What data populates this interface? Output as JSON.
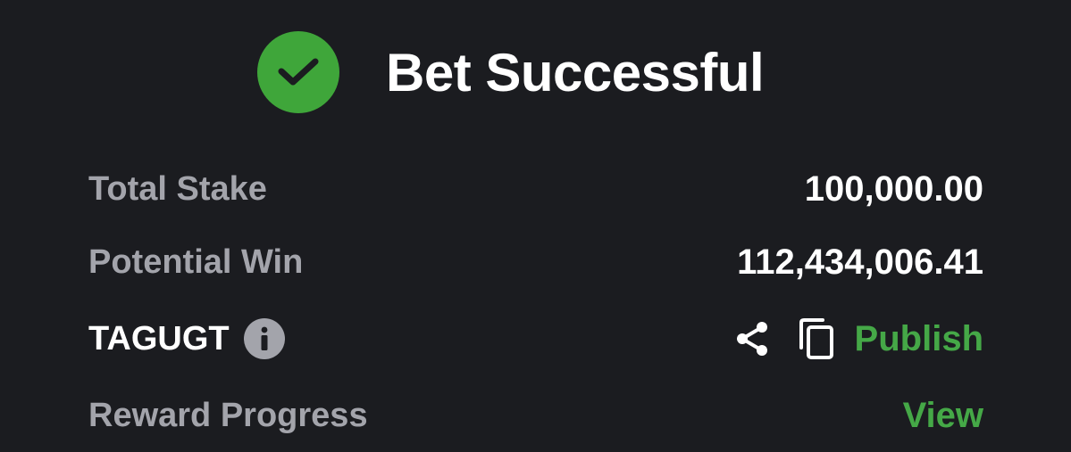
{
  "header": {
    "title": "Bet Successful",
    "icon": "check-circle-icon"
  },
  "rows": {
    "total_stake": {
      "label": "Total Stake",
      "value": "100,000.00"
    },
    "potential_win": {
      "label": "Potential Win",
      "value": "112,434,006.41"
    },
    "code": {
      "label": "TAGUGT",
      "info_icon": "info-icon",
      "share_icon": "share-icon",
      "copy_icon": "copy-icon",
      "action": "Publish"
    },
    "reward_progress": {
      "label": "Reward Progress",
      "action": "View"
    }
  },
  "colors": {
    "background": "#1b1c20",
    "accent_green": "#45a847",
    "check_green": "#3fa63a",
    "label_gray": "#a3a4ab",
    "text_white": "#ffffff"
  }
}
